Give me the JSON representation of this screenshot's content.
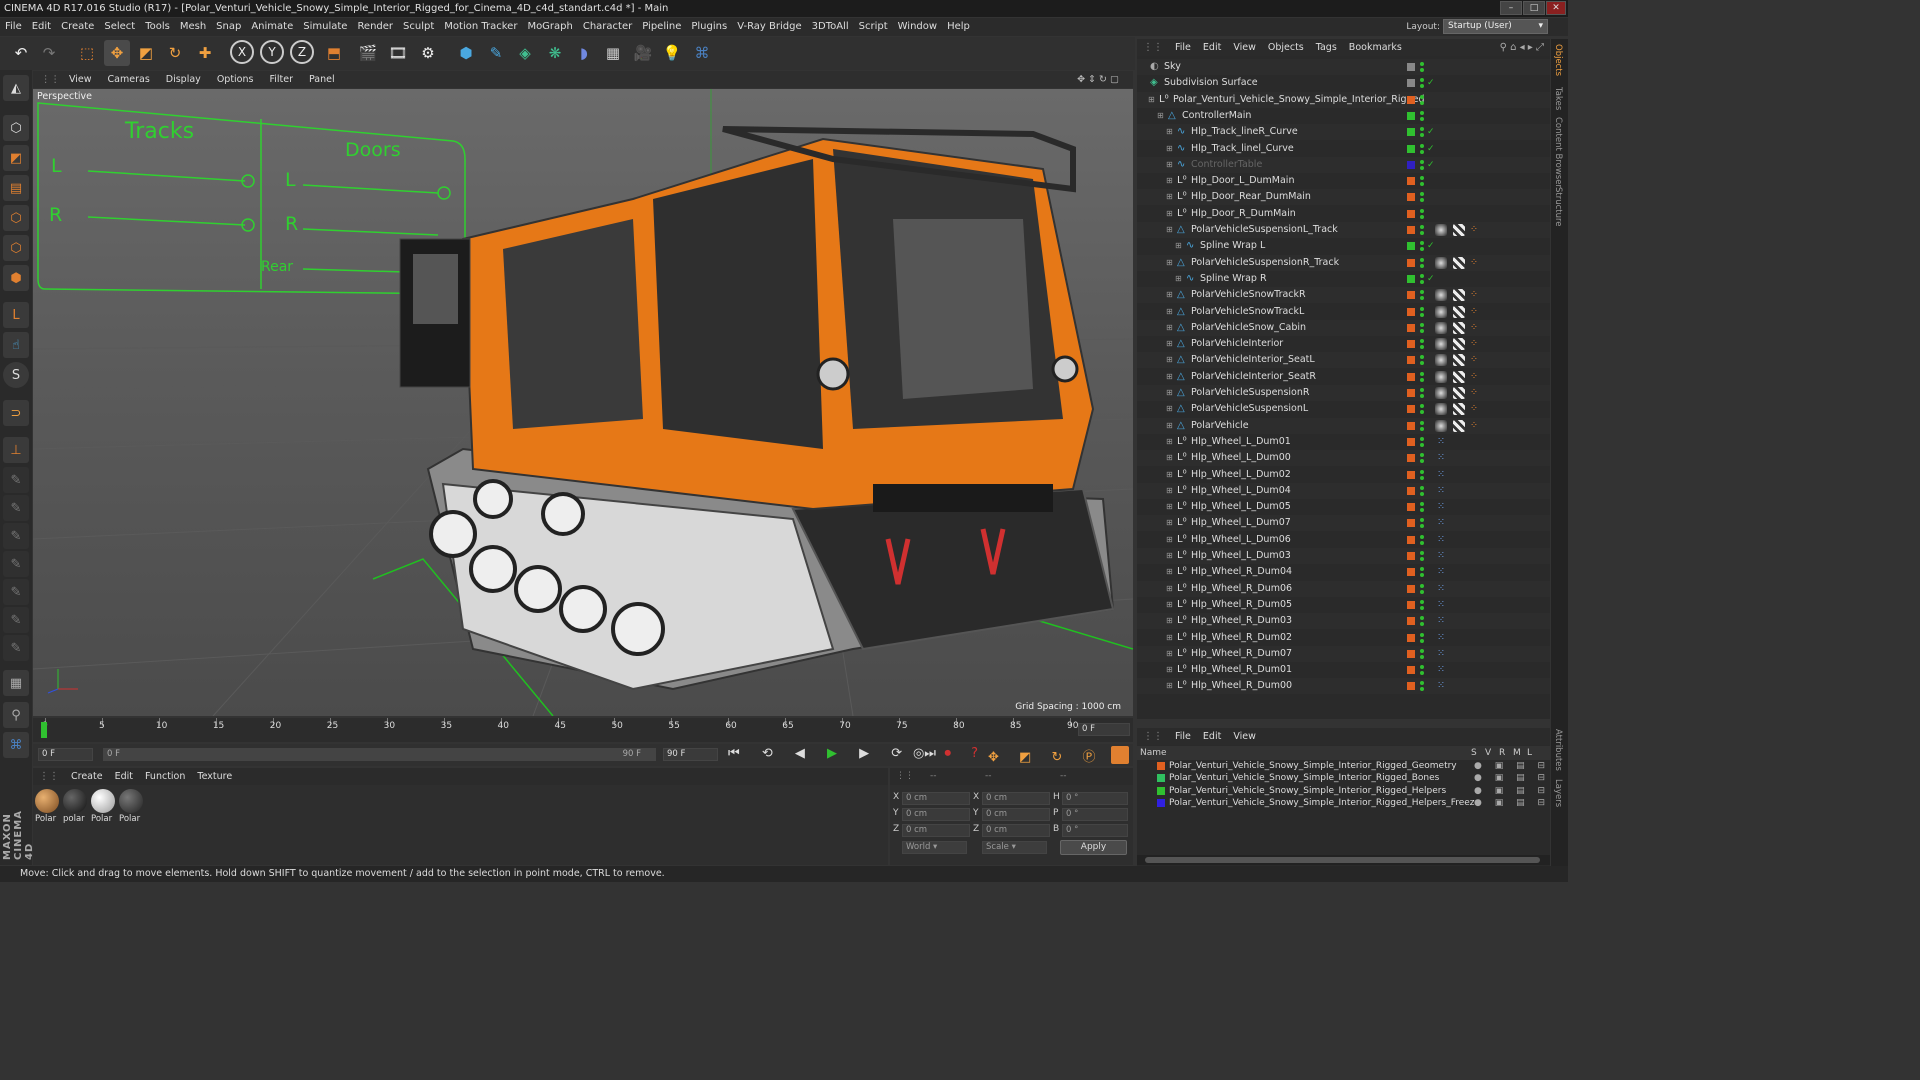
{
  "window": {
    "title": "CINEMA 4D R17.016 Studio (R17) - [Polar_Venturi_Vehicle_Snowy_Simple_Interior_Rigged_for_Cinema_4D_c4d_standart.c4d *] - Main",
    "layout_label": "Layout:",
    "layout_value": "Startup (User)"
  },
  "menu": [
    "File",
    "Edit",
    "Create",
    "Select",
    "Tools",
    "Mesh",
    "Snap",
    "Animate",
    "Simulate",
    "Render",
    "Sculpt",
    "Motion Tracker",
    "MoGraph",
    "Character",
    "Pipeline",
    "Plugins",
    "V-Ray Bridge",
    "3DToAll",
    "Script",
    "Window",
    "Help"
  ],
  "viewport": {
    "menu": [
      "View",
      "Cameras",
      "Display",
      "Options",
      "Filter",
      "Panel"
    ],
    "label": "Perspective",
    "grid_spacing": "Grid Spacing : 1000 cm",
    "controller": {
      "tracks": "Tracks",
      "doors": "Doors",
      "l1": "L",
      "r1": "R",
      "l2": "L",
      "r2": "R",
      "rear": "Rear"
    }
  },
  "timeline": {
    "ticks": [
      "0",
      "5",
      "10",
      "15",
      "20",
      "25",
      "30",
      "35",
      "40",
      "45",
      "50",
      "55",
      "60",
      "65",
      "70",
      "75",
      "80",
      "85",
      "90"
    ],
    "current_frame": "0 F",
    "start_field": "0 F",
    "range_start": "0 F",
    "range_end": "90 F",
    "end_field": "90 F"
  },
  "materials": {
    "menu": [
      "Create",
      "Edit",
      "Function",
      "Texture"
    ],
    "items": [
      "Polar",
      "polar",
      "Polar",
      "Polar"
    ]
  },
  "coords": {
    "labels": [
      "X",
      "Y",
      "Z"
    ],
    "mid_labels": [
      "X",
      "Y",
      "Z"
    ],
    "rot_labels": [
      "H",
      "P",
      "B"
    ],
    "pos": [
      "0 cm",
      "0 cm",
      "0 cm"
    ],
    "size": [
      "0 cm",
      "0 cm",
      "0 cm"
    ],
    "rot": [
      "0 °",
      "0 °",
      "0 °"
    ],
    "world": "World",
    "scale": "Scale",
    "apply": "Apply",
    "header": [
      "--",
      "--",
      "--"
    ]
  },
  "objects": {
    "menu": [
      "File",
      "Edit",
      "View",
      "Objects",
      "Tags",
      "Bookmarks"
    ],
    "rows": [
      {
        "name": "Sky",
        "indent": 0,
        "color": "#888888",
        "icon": "sky"
      },
      {
        "name": "Subdivision Surface",
        "indent": 0,
        "color": "#888888",
        "icon": "subd"
      },
      {
        "name": "Polar_Venturi_Vehicle_Snowy_Simple_Interior_Rigged",
        "indent": 1,
        "color": "#e06020",
        "icon": "null"
      },
      {
        "name": "ControllerMain",
        "indent": 2,
        "color": "#30c030",
        "icon": "poly"
      },
      {
        "name": "Hlp_Track_lineR_Curve",
        "indent": 3,
        "color": "#30c030",
        "icon": "spline"
      },
      {
        "name": "Hlp_Track_linel_Curve",
        "indent": 3,
        "color": "#30c030",
        "icon": "spline"
      },
      {
        "name": "ControllerTable",
        "indent": 3,
        "color": "#3020c0",
        "icon": "spline"
      },
      {
        "name": "Hlp_Door_L_DumMain",
        "indent": 3,
        "color": "#e06020",
        "icon": "null"
      },
      {
        "name": "Hlp_Door_Rear_DumMain",
        "indent": 3,
        "color": "#e06020",
        "icon": "null"
      },
      {
        "name": "Hlp_Door_R_DumMain",
        "indent": 3,
        "color": "#e06020",
        "icon": "null"
      },
      {
        "name": "PolarVehicleSuspensionL_Track",
        "indent": 3,
        "color": "#e06020",
        "icon": "poly"
      },
      {
        "name": "Spline Wrap L",
        "indent": 4,
        "color": "#30c030",
        "icon": "spline"
      },
      {
        "name": "PolarVehicleSuspensionR_Track",
        "indent": 3,
        "color": "#e06020",
        "icon": "poly"
      },
      {
        "name": "Spline Wrap R",
        "indent": 4,
        "color": "#30c030",
        "icon": "spline"
      },
      {
        "name": "PolarVehicleSnowTrackR",
        "indent": 3,
        "color": "#e06020",
        "icon": "poly"
      },
      {
        "name": "PolarVehicleSnowTrackL",
        "indent": 3,
        "color": "#e06020",
        "icon": "poly"
      },
      {
        "name": "PolarVehicleSnow_Cabin",
        "indent": 3,
        "color": "#e06020",
        "icon": "poly"
      },
      {
        "name": "PolarVehicleInterior",
        "indent": 3,
        "color": "#e06020",
        "icon": "poly"
      },
      {
        "name": "PolarVehicleInterior_SeatL",
        "indent": 3,
        "color": "#e06020",
        "icon": "poly"
      },
      {
        "name": "PolarVehicleInterior_SeatR",
        "indent": 3,
        "color": "#e06020",
        "icon": "poly"
      },
      {
        "name": "PolarVehicleSuspensionR",
        "indent": 3,
        "color": "#e06020",
        "icon": "poly"
      },
      {
        "name": "PolarVehicleSuspensionL",
        "indent": 3,
        "color": "#e06020",
        "icon": "poly"
      },
      {
        "name": "PolarVehicle",
        "indent": 3,
        "color": "#e06020",
        "icon": "poly"
      },
      {
        "name": "Hlp_Wheel_L_Dum01",
        "indent": 3,
        "color": "#e06020",
        "icon": "null"
      },
      {
        "name": "Hlp_Wheel_L_Dum00",
        "indent": 3,
        "color": "#e06020",
        "icon": "null"
      },
      {
        "name": "Hlp_Wheel_L_Dum02",
        "indent": 3,
        "color": "#e06020",
        "icon": "null"
      },
      {
        "name": "Hlp_Wheel_L_Dum04",
        "indent": 3,
        "color": "#e06020",
        "icon": "null"
      },
      {
        "name": "Hlp_Wheel_L_Dum05",
        "indent": 3,
        "color": "#e06020",
        "icon": "null"
      },
      {
        "name": "Hlp_Wheel_L_Dum07",
        "indent": 3,
        "color": "#e06020",
        "icon": "null"
      },
      {
        "name": "Hlp_Wheel_L_Dum06",
        "indent": 3,
        "color": "#e06020",
        "icon": "null"
      },
      {
        "name": "Hlp_Wheel_L_Dum03",
        "indent": 3,
        "color": "#e06020",
        "icon": "null"
      },
      {
        "name": "Hlp_Wheel_R_Dum04",
        "indent": 3,
        "color": "#e06020",
        "icon": "null"
      },
      {
        "name": "Hlp_Wheel_R_Dum06",
        "indent": 3,
        "color": "#e06020",
        "icon": "null"
      },
      {
        "name": "Hlp_Wheel_R_Dum05",
        "indent": 3,
        "color": "#e06020",
        "icon": "null"
      },
      {
        "name": "Hlp_Wheel_R_Dum03",
        "indent": 3,
        "color": "#e06020",
        "icon": "null"
      },
      {
        "name": "Hlp_Wheel_R_Dum02",
        "indent": 3,
        "color": "#e06020",
        "icon": "null"
      },
      {
        "name": "Hlp_Wheel_R_Dum07",
        "indent": 3,
        "color": "#e06020",
        "icon": "null"
      },
      {
        "name": "Hlp_Wheel_R_Dum01",
        "indent": 3,
        "color": "#e06020",
        "icon": "null"
      },
      {
        "name": "Hlp_Wheel_R_Dum00",
        "indent": 3,
        "color": "#e06020",
        "icon": "null"
      }
    ]
  },
  "layers": {
    "menu": [
      "File",
      "Edit",
      "View"
    ],
    "header": {
      "name": "Name",
      "cols": [
        "S",
        "V",
        "R",
        "M",
        "L"
      ]
    },
    "rows": [
      {
        "name": "Polar_Venturi_Vehicle_Snowy_Simple_Interior_Rigged_Geometry",
        "color": "#e06020"
      },
      {
        "name": "Polar_Venturi_Vehicle_Snowy_Simple_Interior_Rigged_Bones",
        "color": "#30c060"
      },
      {
        "name": "Polar_Venturi_Vehicle_Snowy_Simple_Interior_Rigged_Helpers",
        "color": "#30c030"
      },
      {
        "name": "Polar_Venturi_Vehicle_Snowy_Simple_Interior_Rigged_Helpers_Freeze",
        "color": "#3020e0"
      }
    ]
  },
  "right_tabs": [
    "Objects",
    "Takes",
    "Content Browser",
    "Structure",
    "Attributes",
    "Layers"
  ],
  "status": "Move: Click and drag to move elements. Hold down SHIFT to quantize movement / add to the selection in point mode, CTRL to remove.",
  "maxon": "MAXON CINEMA 4D"
}
